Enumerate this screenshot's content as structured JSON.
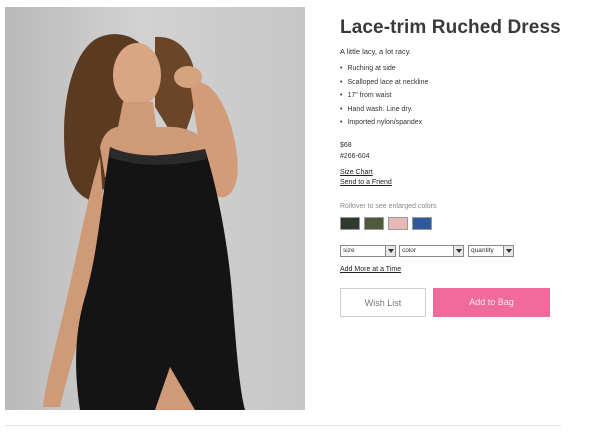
{
  "product": {
    "title": "Lace-trim Ruched Dress",
    "tagline": "A little lacy, a lot racy.",
    "features": [
      "Ruching at side",
      "Scalloped lace at neckline",
      "17\" from waist",
      "Hand wash. Line dry.",
      "Imported nylon/spandex"
    ],
    "price": "$68",
    "sku": "#266-604"
  },
  "links": {
    "size_chart": "Size Chart",
    "send_to_friend": "Send to a Friend",
    "add_more": "Add More at a Time"
  },
  "colors": {
    "hint": "Rollover to see enlarged colors",
    "swatches": [
      {
        "name": "black-lace",
        "color": "#2f3a2e"
      },
      {
        "name": "green-lace",
        "color": "#4f5a3c"
      },
      {
        "name": "pink-lace",
        "color": "#e6b9b6"
      },
      {
        "name": "blue-lace",
        "color": "#2c5a9c"
      }
    ]
  },
  "selects": {
    "size": "size",
    "color": "color",
    "quantity": "quantity"
  },
  "buttons": {
    "wish_list": "Wish List",
    "add_to_bag": "Add to Bag"
  },
  "theme": {
    "accent": "#f06a9b"
  }
}
